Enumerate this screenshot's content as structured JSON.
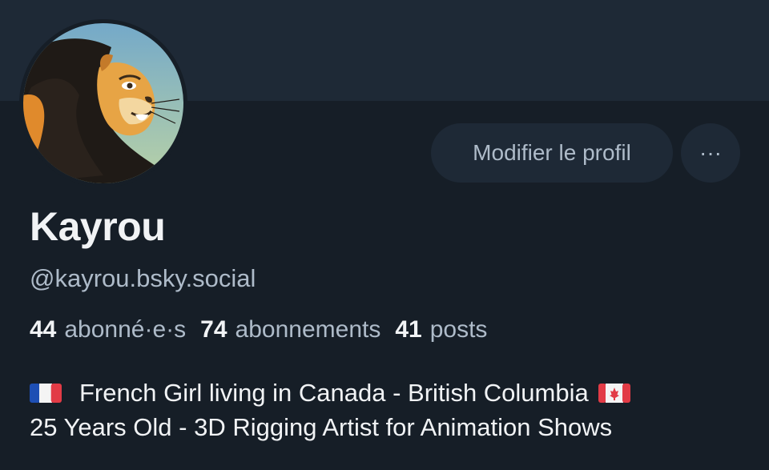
{
  "profile": {
    "display_name": "Kayrou",
    "handle": "@kayrou.bsky.social",
    "avatar_icon": "lion-avatar-icon"
  },
  "actions": {
    "edit_label": "Modifier le profil",
    "more_label": "···"
  },
  "stats": {
    "followers_count": "44",
    "followers_label": "abonné·e·s",
    "following_count": "74",
    "following_label": "abonnements",
    "posts_count": "41",
    "posts_label": "posts"
  },
  "bio": {
    "line1": "French Girl living in Canada - British Columbia",
    "line2": "25 Years Old - 3D Rigging Artist for Animation Shows",
    "flag1_icon": "france-flag-icon",
    "flag2_icon": "canada-flag-icon"
  },
  "colors": {
    "background": "#161e27",
    "banner": "#1e2936",
    "button": "#1e2936",
    "text_primary": "#f1f3f5",
    "text_secondary": "#aebbc9"
  }
}
